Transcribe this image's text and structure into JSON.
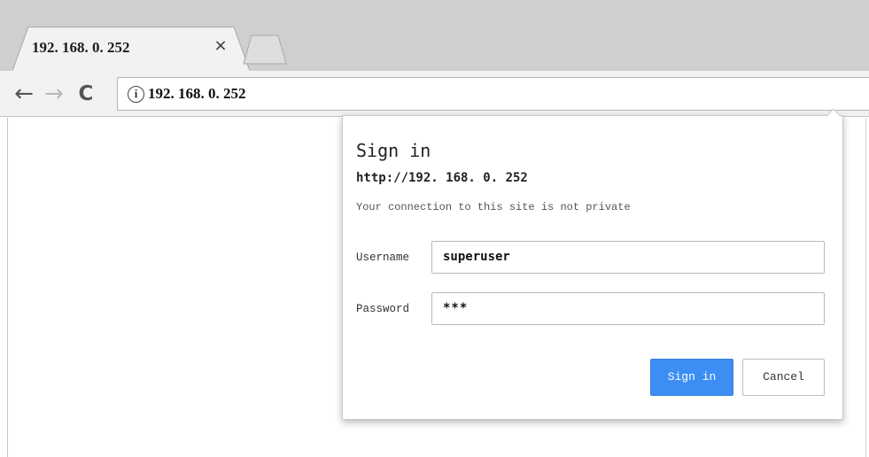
{
  "browser": {
    "tab": {
      "title": "192. 168. 0. 252",
      "close_glyph": "×"
    },
    "new_tab_icon": "new-tab-icon",
    "nav": {
      "back_glyph": "←",
      "forward_glyph": "→",
      "reload_glyph": "C"
    },
    "omnibox": {
      "security_icon": "info-icon",
      "security_glyph": "i",
      "url": "192. 168. 0. 252"
    }
  },
  "dialog": {
    "title": "Sign in",
    "origin": "http://192. 168. 0. 252",
    "warning": "Your connection to this site is not private",
    "username": {
      "label": "Username",
      "value": "superuser"
    },
    "password": {
      "label": "Password",
      "value": "***"
    },
    "buttons": {
      "sign_in": "Sign in",
      "cancel": "Cancel"
    }
  },
  "colors": {
    "tabstrip": "#cfcfcf",
    "toolbar": "#f2f2f2",
    "primary_button": "#3c8ef3"
  }
}
